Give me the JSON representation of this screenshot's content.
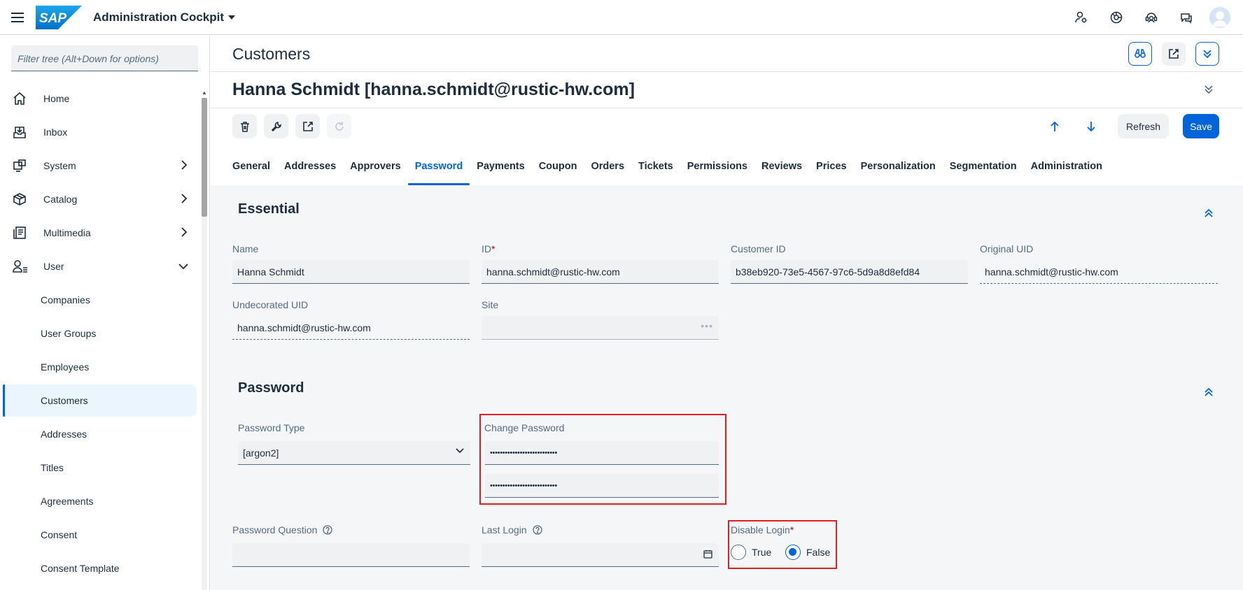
{
  "shell": {
    "logo_text": "SAP",
    "app_title": "Administration Cockpit",
    "actions": [
      "user-settings-icon",
      "help-wheel-icon",
      "support-icon",
      "notifications-icon",
      "user-avatar"
    ]
  },
  "sidebar": {
    "filter_placeholder": "Filter tree (Alt+Down for options)",
    "items": [
      {
        "label": "Home",
        "icon": "home-icon"
      },
      {
        "label": "Inbox",
        "icon": "inbox-icon"
      },
      {
        "label": "System",
        "icon": "system-icon",
        "expandable": true
      },
      {
        "label": "Catalog",
        "icon": "catalog-icon",
        "expandable": true
      },
      {
        "label": "Multimedia",
        "icon": "multimedia-icon",
        "expandable": true
      },
      {
        "label": "User",
        "icon": "user-icon",
        "expanded": true
      }
    ],
    "subitems": [
      {
        "label": "Companies"
      },
      {
        "label": "User Groups"
      },
      {
        "label": "Employees"
      },
      {
        "label": "Customers",
        "selected": true
      },
      {
        "label": "Addresses"
      },
      {
        "label": "Titles"
      },
      {
        "label": "Agreements"
      },
      {
        "label": "Consent"
      },
      {
        "label": "Consent Template"
      }
    ]
  },
  "main": {
    "page_title": "Customers",
    "object_title": "Hanna Schmidt [hanna.schmidt@rustic-hw.com]",
    "toolbar": {
      "refresh_label": "Refresh",
      "save_label": "Save"
    },
    "tabs": [
      {
        "label": "General"
      },
      {
        "label": "Addresses"
      },
      {
        "label": "Approvers"
      },
      {
        "label": "Password",
        "active": true
      },
      {
        "label": "Payments"
      },
      {
        "label": "Coupon"
      },
      {
        "label": "Orders"
      },
      {
        "label": "Tickets"
      },
      {
        "label": "Permissions"
      },
      {
        "label": "Reviews"
      },
      {
        "label": "Prices"
      },
      {
        "label": "Personalization"
      },
      {
        "label": "Segmentation"
      },
      {
        "label": "Administration"
      }
    ],
    "essential": {
      "title": "Essential",
      "name_label": "Name",
      "name_value": "Hanna Schmidt",
      "id_label": "ID",
      "id_required": "*",
      "id_value": "hanna.schmidt@rustic-hw.com",
      "customer_id_label": "Customer ID",
      "customer_id_value": "b38eb920-73e5-4567-97c6-5d9a8d8efd84",
      "original_uid_label": "Original UID",
      "original_uid_value": "hanna.schmidt@rustic-hw.com",
      "undecorated_uid_label": "Undecorated UID",
      "undecorated_uid_value": "hanna.schmidt@rustic-hw.com",
      "site_label": "Site",
      "site_value": "",
      "site_more": "•••"
    },
    "password": {
      "title": "Password",
      "type_label": "Password Type",
      "type_value": "[argon2]",
      "change_label": "Change Password",
      "new_password_mask": "•••••••••••••••••••••••••••",
      "confirm_password_mask": "•••••••••••••••••••••••••••",
      "question_label": "Password Question",
      "question_value": "",
      "last_login_label": "Last Login",
      "last_login_value": "",
      "disable_login_label": "Disable Login",
      "disable_login_required": "*",
      "option_true": "True",
      "option_false": "False",
      "disable_login_selected": "False"
    }
  },
  "colors": {
    "accent": "#0064d9",
    "highlight": "#e01e1e",
    "required": "#aa0808"
  }
}
